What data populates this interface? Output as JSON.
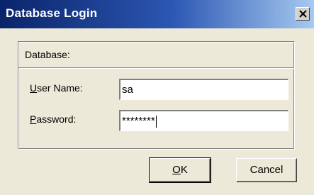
{
  "window": {
    "title": "Database Login",
    "close_icon": "close-icon"
  },
  "panel": {
    "database_label": "Database:"
  },
  "fields": {
    "username": {
      "label_accel": "U",
      "label_rest": "ser Name:",
      "value": "sa"
    },
    "password": {
      "label_accel": "P",
      "label_rest": "assword:",
      "value": "********"
    }
  },
  "buttons": {
    "ok_accel": "O",
    "ok_rest": "K",
    "cancel": "Cancel"
  },
  "colors": {
    "titlebar_start": "#0a246a",
    "titlebar_end": "#a6caf0",
    "dialog_bg": "#ece9d8"
  }
}
